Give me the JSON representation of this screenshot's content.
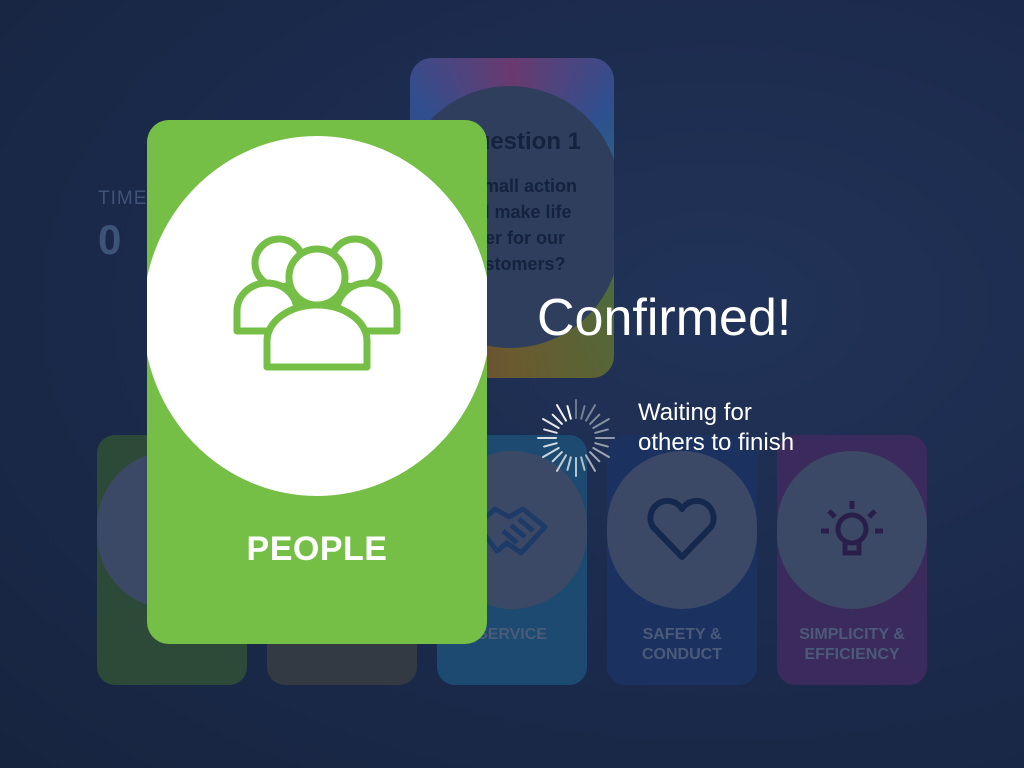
{
  "timer": {
    "label": "TIME",
    "value": "0"
  },
  "question_card": {
    "title": "Question 1",
    "text": "small action\nd make life\ner for our\nstomers?"
  },
  "value_cards": [
    {
      "key": "people",
      "label": "P",
      "icon": "people-icon",
      "color": "#2d4a38"
    },
    {
      "key": "hidden-dark",
      "label": "",
      "icon": "",
      "color": "#343a44"
    },
    {
      "key": "service",
      "label": "SERVICE",
      "icon": "handshake-icon",
      "color": "#1d4a70"
    },
    {
      "key": "safety",
      "label": "SAFETY &\nCONDUCT",
      "icon": "heart-icon",
      "color": "#1b3260"
    },
    {
      "key": "simplicity",
      "label": "SIMPLICITY &\nEFFICIENCY",
      "icon": "lightbulb-icon",
      "color": "#3b2b5c"
    }
  ],
  "selected_card": {
    "name": "PEOPLE",
    "icon": "people-icon",
    "color": "#76bf46"
  },
  "status": {
    "title": "Confirmed!",
    "waiting_line1": "Waiting for",
    "waiting_line2": "others to finish"
  }
}
